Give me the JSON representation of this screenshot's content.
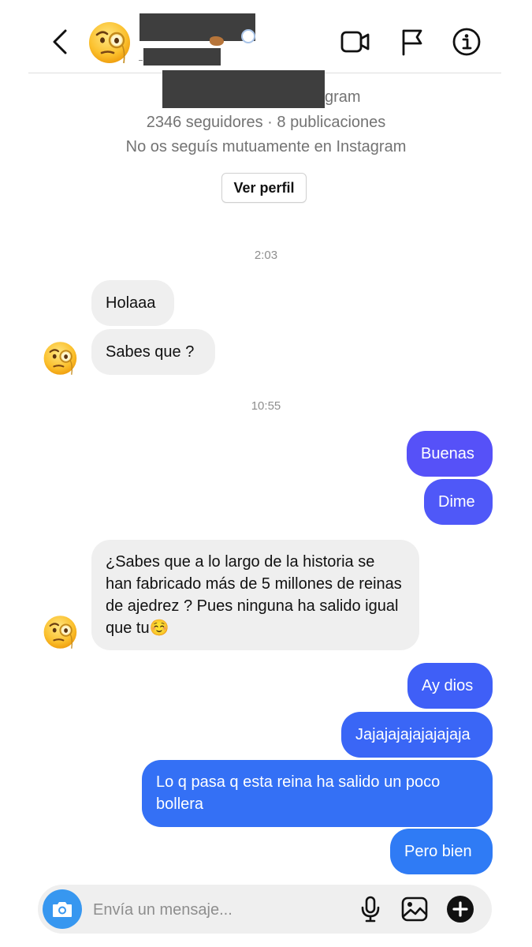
{
  "header": {
    "back_icon": "chevron-left-icon",
    "avatar_icon": "face-with-monocle-emoji",
    "video_icon": "video-camera-icon",
    "flag_icon": "flag-icon",
    "info_icon": "info-icon"
  },
  "profile": {
    "username_suffix": "gram",
    "stats": "2346 seguidores · 8 publicaciones",
    "relationship": "No os seguís mutuamente en Instagram",
    "view_profile_label": "Ver perfil"
  },
  "thread": {
    "timestamps": [
      "2:03",
      "10:55"
    ],
    "messages": [
      {
        "from": "them",
        "text": "Holaaa"
      },
      {
        "from": "them",
        "text": "Sabes que ?"
      },
      {
        "from": "me",
        "text": "Buenas"
      },
      {
        "from": "me",
        "text": "Dime"
      },
      {
        "from": "them",
        "text": "¿Sabes que a lo largo de la historia se han fabricado más de 5 millones de reinas de ajedrez ? Pues ninguna ha salido igual que tu☺️"
      },
      {
        "from": "me",
        "text": "Ay dios"
      },
      {
        "from": "me",
        "text": "Jajajajajajajajaja"
      },
      {
        "from": "me",
        "text": "Lo q pasa q esta reina ha salido un poco bollera"
      },
      {
        "from": "me",
        "text": "Pero bien"
      }
    ]
  },
  "composer": {
    "placeholder": "Envía un mensaje...",
    "camera_icon": "camera-icon",
    "mic_icon": "microphone-icon",
    "gallery_icon": "image-icon",
    "plus_icon": "plus-circle-icon"
  },
  "colors": {
    "bubble_incoming": "#efefef",
    "bubble_out_top": "#5b51f8",
    "bubble_out_mid": "#3f5ef7",
    "bubble_out_bottom": "#2f7bf5",
    "camera_button": "#3797f0"
  }
}
